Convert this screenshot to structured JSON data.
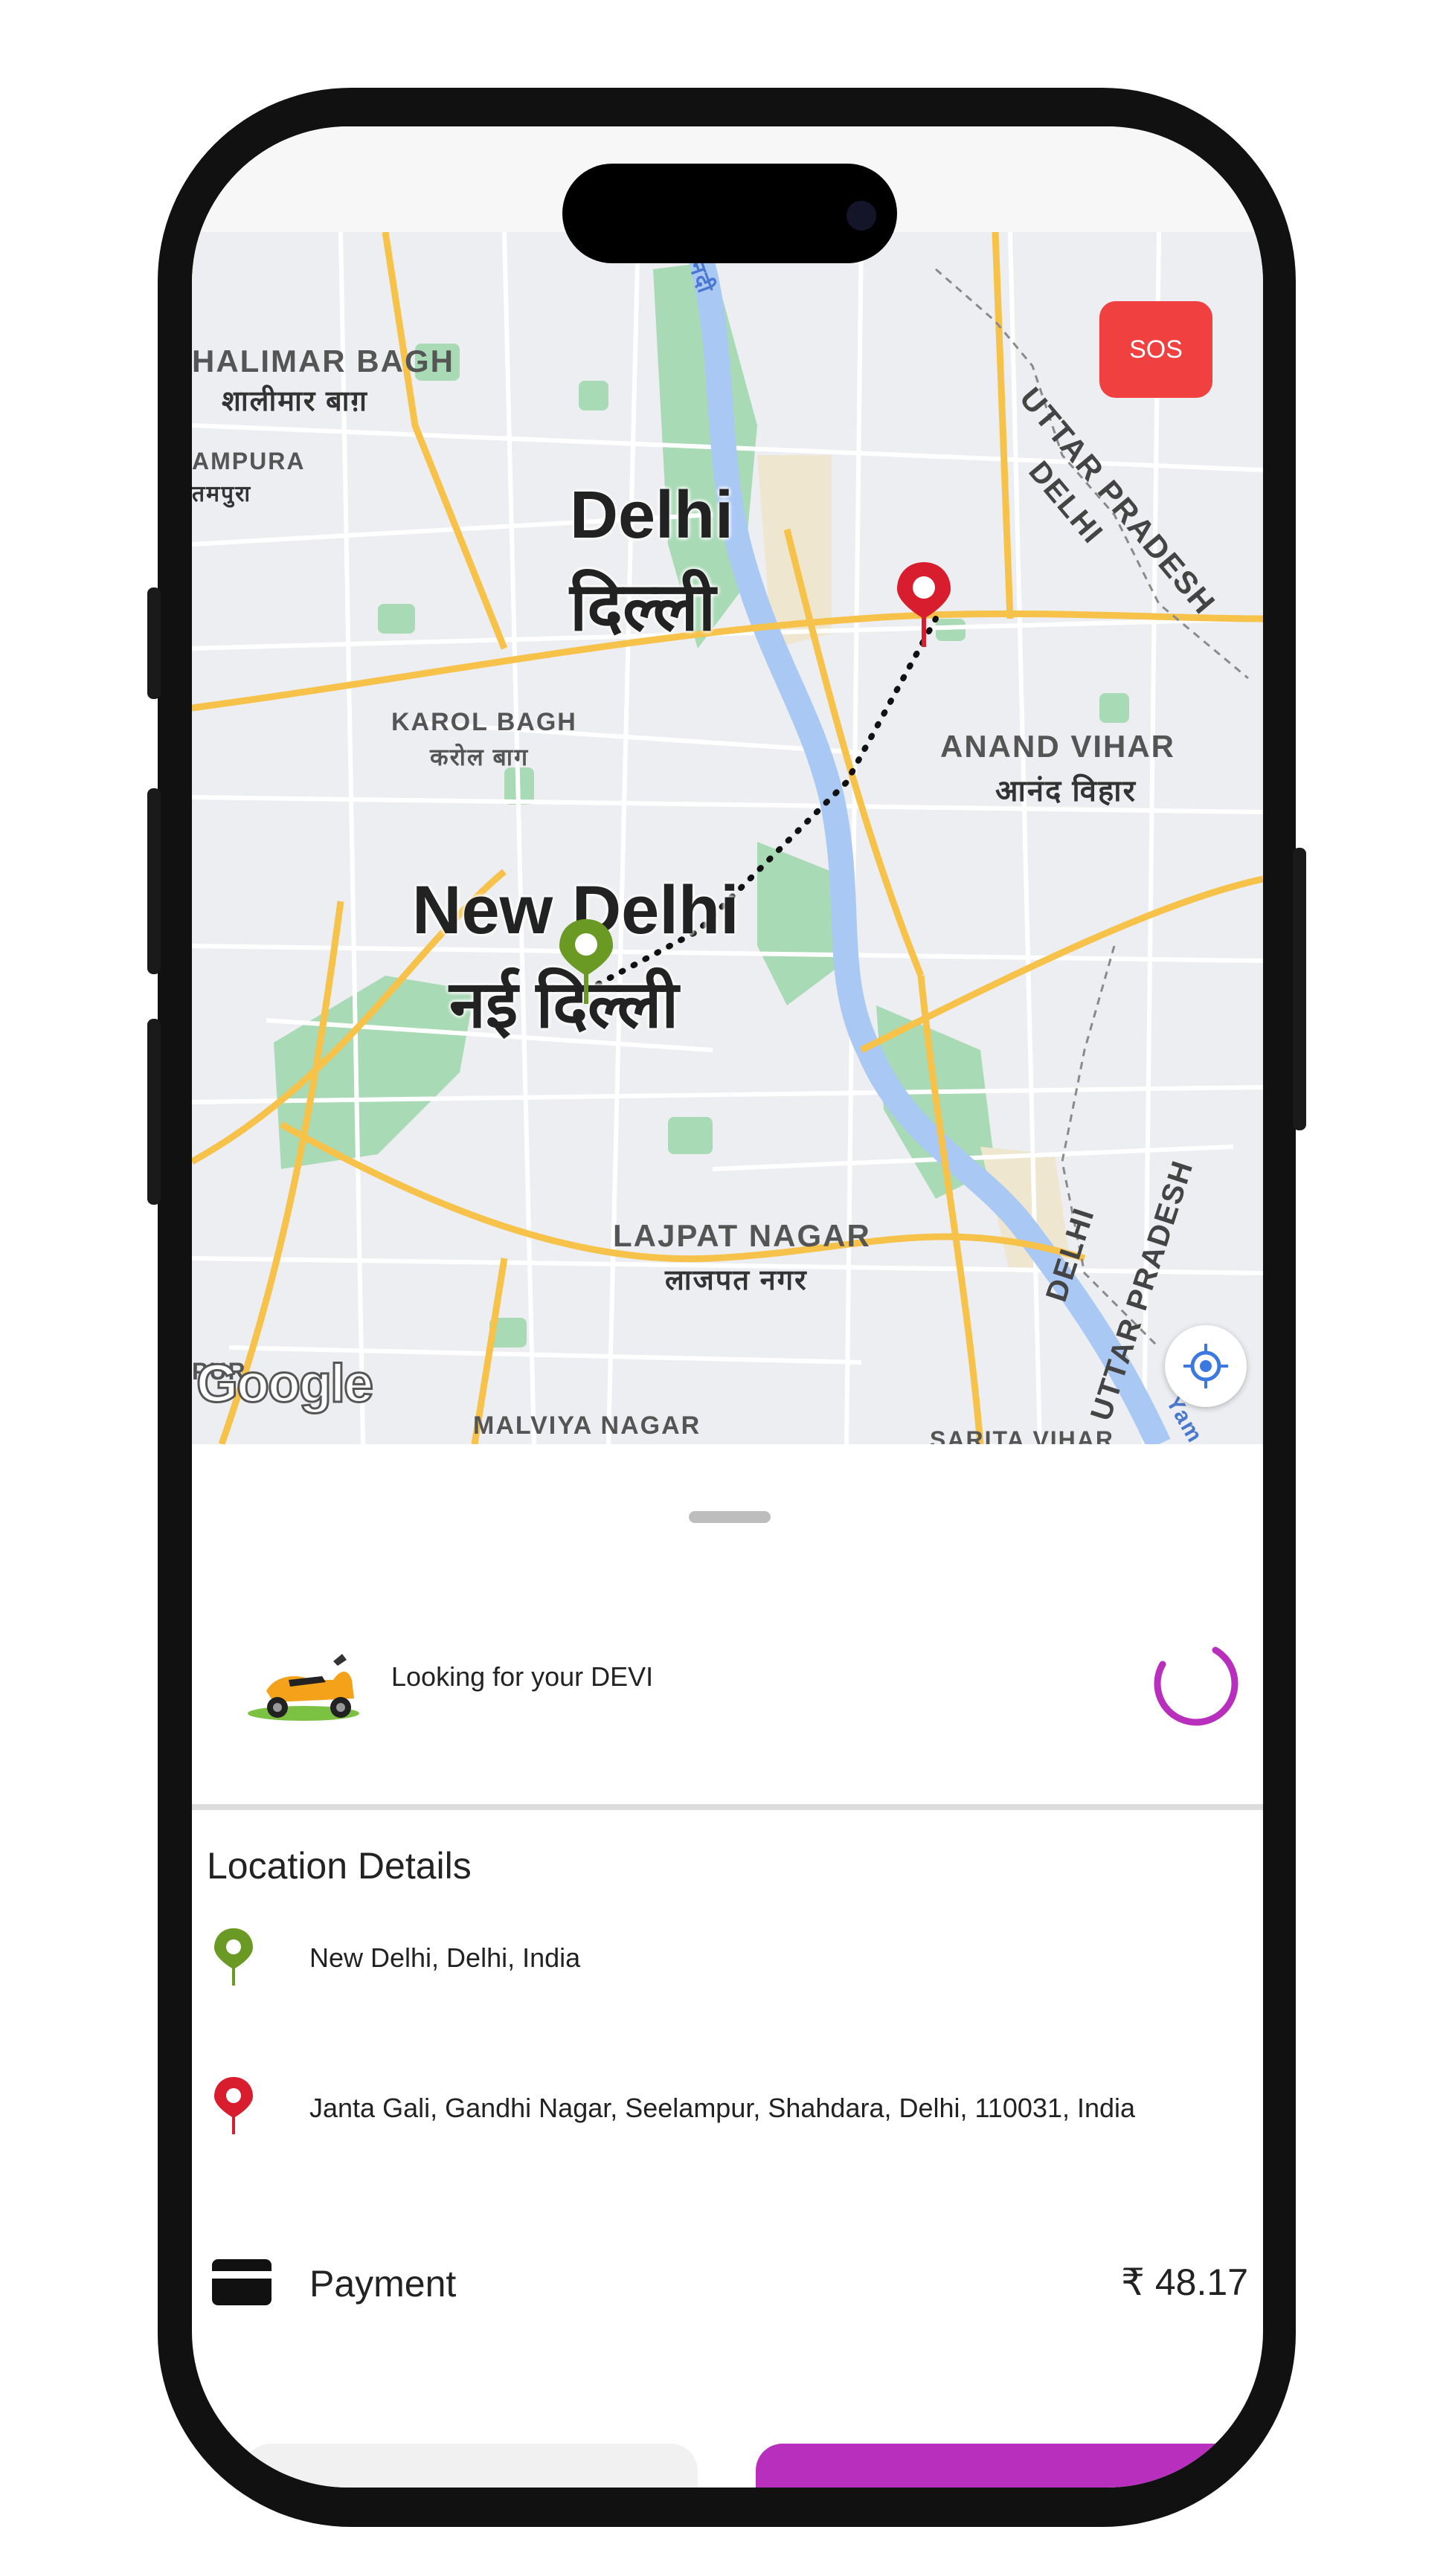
{
  "status_bar": {},
  "map": {
    "provider_logo": "Google",
    "sos_label": "SOS",
    "labels": {
      "shalimar_bagh_en": "HALIMAR BAGH",
      "shalimar_bagh_hi": "शालीमार बाग़",
      "ampura_en": "AMPURA",
      "ampura_hi": "तमपुरा",
      "delhi_en": "Delhi",
      "delhi_hi": "दिल्ली",
      "karol_bagh_en": "KAROL BAGH",
      "karol_bagh_hi": "करोल बाग",
      "new_delhi_en": "New Delhi",
      "new_delhi_hi": "नई दिल्ली",
      "anand_vihar_en": "ANAND VIHAR",
      "anand_vihar_hi": "आनंद विहार",
      "lajpat_nagar_en": "LAJPAT NAGAR",
      "lajpat_nagar_hi": "लाजपत नगर",
      "malviya_nagar": "MALVIYA NAGAR",
      "sarita_vihar": "SARITA VIHAR",
      "uttar_pradesh_top": "UTTAR PRADESH",
      "delhi_border_top": "DELHI",
      "delhi_border_bottom": "DELHI",
      "uttar_pradesh_bottom": "UTTAR PRADESH",
      "pur": "PUR",
      "river_hi": "नदी",
      "yamuna": "Yam"
    }
  },
  "ride_status": {
    "text": "Looking for your DEVI"
  },
  "location_details": {
    "title": "Location Details",
    "pickup": "New Delhi, Delhi, India",
    "drop": "Janta Gali, Gandhi Nagar, Seelampur, Shahdara, Delhi, 110031, India"
  },
  "payment": {
    "label": "Payment",
    "amount": "₹ 48.17"
  },
  "colors": {
    "accent": "#b82ebd",
    "pickup_pin": "#6a9a23",
    "drop_pin": "#d81e2e",
    "sos": "#f04040"
  }
}
